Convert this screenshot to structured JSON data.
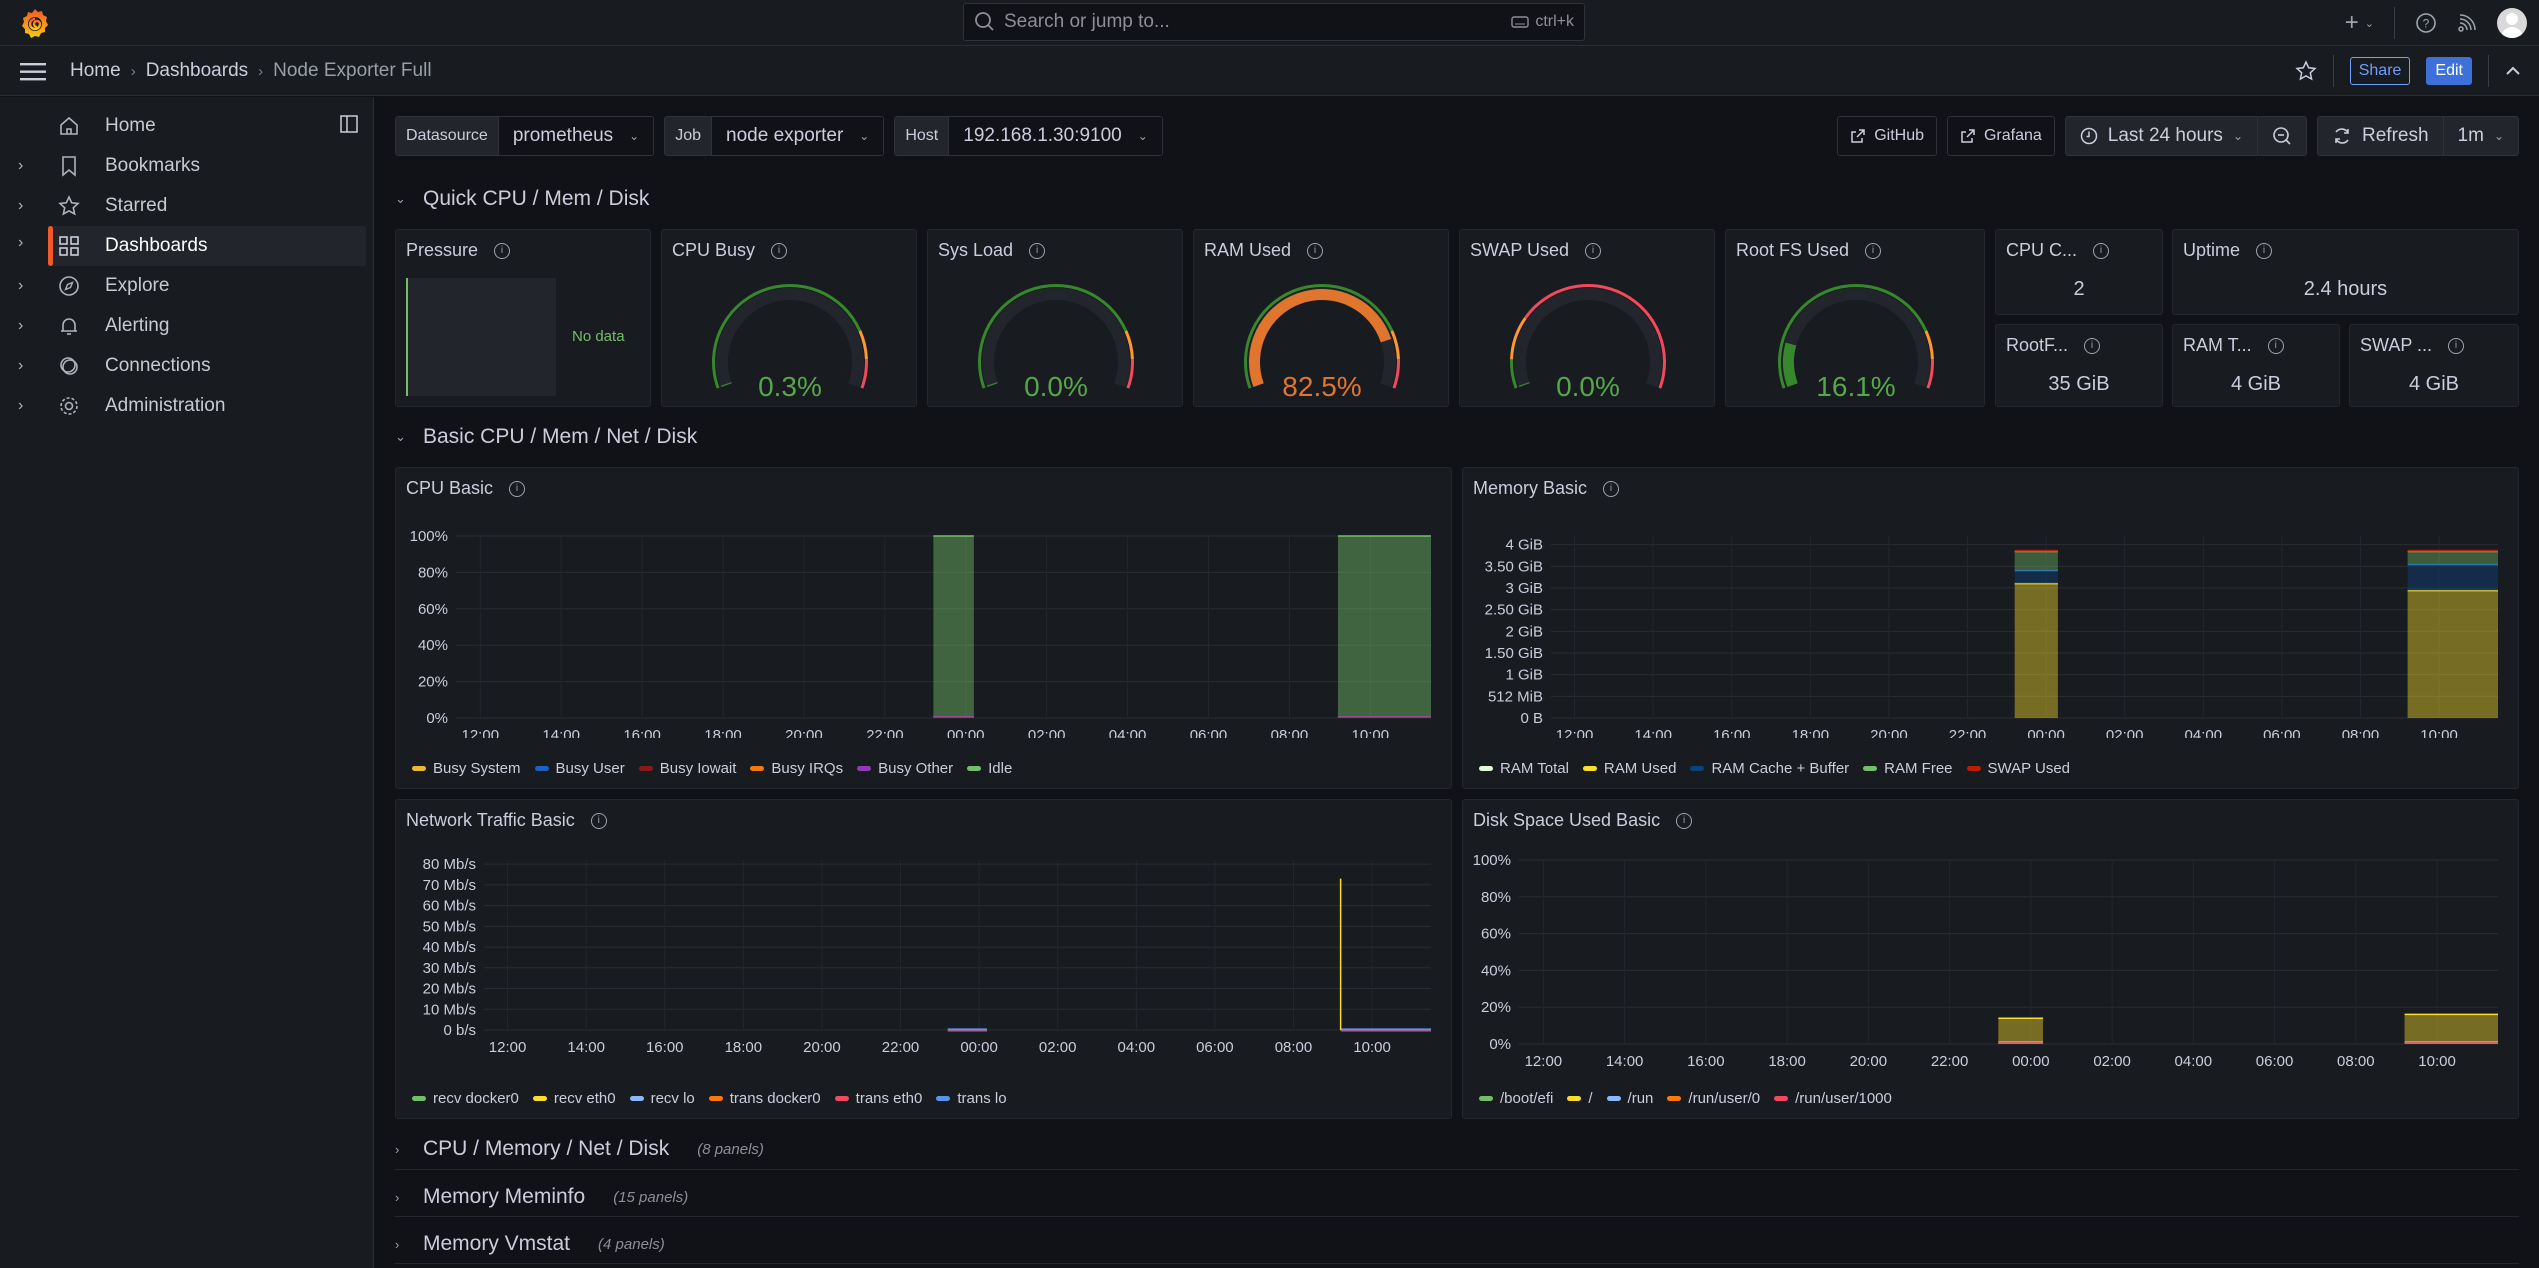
{
  "topbar": {
    "search_placeholder": "Search or jump to...",
    "search_shortcut": "ctrl+k",
    "icons": [
      "grafana-logo",
      "plus-icon",
      "help-icon",
      "news-rss-icon",
      "user-avatar"
    ]
  },
  "breadcrumb": {
    "items": [
      "Home",
      "Dashboards",
      "Node Exporter Full"
    ]
  },
  "navbar": {
    "share_label": "Share",
    "edit_label": "Edit"
  },
  "sidebar": {
    "items": [
      {
        "label": "Home",
        "icon": "home-icon",
        "expandable": false
      },
      {
        "label": "Bookmarks",
        "icon": "bookmark-icon",
        "expandable": true
      },
      {
        "label": "Starred",
        "icon": "star-icon",
        "expandable": true
      },
      {
        "label": "Dashboards",
        "icon": "apps-icon",
        "expandable": true,
        "active": true
      },
      {
        "label": "Explore",
        "icon": "compass-icon",
        "expandable": true
      },
      {
        "label": "Alerting",
        "icon": "bell-icon",
        "expandable": true
      },
      {
        "label": "Connections",
        "icon": "connections-icon",
        "expandable": true
      },
      {
        "label": "Administration",
        "icon": "cog-icon",
        "expandable": true
      }
    ]
  },
  "variables": [
    {
      "label": "Datasource",
      "value": "prometheus"
    },
    {
      "label": "Job",
      "value": "node exporter"
    },
    {
      "label": "Host",
      "value": "192.168.1.30:9100"
    }
  ],
  "controls": {
    "links": [
      "GitHub",
      "Grafana"
    ],
    "time_range": "Last 24 hours",
    "refresh_label": "Refresh",
    "refresh_interval": "1m"
  },
  "rows": [
    {
      "title": "Quick CPU / Mem / Disk",
      "expanded": true
    },
    {
      "title": "Basic CPU / Mem / Net / Disk",
      "expanded": true
    },
    {
      "title": "CPU / Memory / Net / Disk",
      "expanded": false,
      "count": "(8 panels)"
    },
    {
      "title": "Memory Meminfo",
      "expanded": false,
      "count": "(15 panels)"
    },
    {
      "title": "Memory Vmstat",
      "expanded": false,
      "count": "(4 panels)"
    }
  ],
  "quick_panels": {
    "pressure": {
      "title": "Pressure",
      "value": "No data"
    },
    "gauges": [
      {
        "title": "CPU Busy",
        "value": "0.3%",
        "fraction": 0.003,
        "color": "#37872d",
        "text_color": "#56a64b",
        "thresholds": "green-orange-red"
      },
      {
        "title": "Sys Load",
        "value": "0.0%",
        "fraction": 0.0,
        "color": "#37872d",
        "text_color": "#56a64b",
        "thresholds": "green-orange-red"
      },
      {
        "title": "RAM Used",
        "value": "82.5%",
        "fraction": 0.825,
        "color": "#e0752d",
        "text_color": "#e0752d",
        "thresholds": "green-orange-red"
      },
      {
        "title": "SWAP Used",
        "value": "0.0%",
        "fraction": 0.0,
        "color": "#37872d",
        "text_color": "#56a64b",
        "thresholds": "green-orange-red-swap"
      },
      {
        "title": "Root FS Used",
        "value": "16.1%",
        "fraction": 0.161,
        "color": "#37872d",
        "text_color": "#56a64b",
        "thresholds": "green-orange-red"
      }
    ],
    "stats": [
      {
        "title": "CPU C...",
        "value": "2"
      },
      {
        "title": "Uptime",
        "value": "2.4 hours"
      },
      {
        "title": "RootF...",
        "value": "35 GiB"
      },
      {
        "title": "RAM T...",
        "value": "4 GiB"
      },
      {
        "title": "SWAP ...",
        "value": "4 GiB"
      }
    ]
  },
  "chart_data": [
    {
      "type": "area",
      "title": "CPU Basic",
      "x_ticks": [
        "12:00",
        "14:00",
        "16:00",
        "18:00",
        "20:00",
        "22:00",
        "00:00",
        "02:00",
        "04:00",
        "06:00",
        "08:00",
        "10:00"
      ],
      "y_ticks": [
        "0%",
        "20%",
        "40%",
        "60%",
        "80%",
        "100%"
      ],
      "ylim": [
        0,
        100
      ],
      "x_range_hours": [
        11.4,
        35.5
      ],
      "series": [
        {
          "name": "Busy System",
          "color": "#eab839",
          "segments": [
            [
              23.2,
              24.2,
              0.2
            ],
            [
              33.2,
              35.5,
              0.2
            ]
          ]
        },
        {
          "name": "Busy User",
          "color": "#1f60c4",
          "segments": [
            [
              23.2,
              24.2,
              0.1
            ],
            [
              33.2,
              35.5,
              0.1
            ]
          ]
        },
        {
          "name": "Busy Iowait",
          "color": "#8a1a1a",
          "segments": [
            [
              23.2,
              24.2,
              0.0
            ],
            [
              33.2,
              35.5,
              0.0
            ]
          ]
        },
        {
          "name": "Busy IRQs",
          "color": "#f2790f",
          "segments": [
            [
              23.2,
              24.2,
              0.0
            ],
            [
              33.2,
              35.5,
              0.0
            ]
          ]
        },
        {
          "name": "Busy Other",
          "color": "#8f3bb8",
          "segments": [
            [
              23.2,
              24.2,
              0.0
            ],
            [
              33.2,
              35.5,
              0.0
            ]
          ]
        },
        {
          "name": "Idle",
          "color": "#73bf69",
          "segments": [
            [
              23.2,
              24.2,
              99.7
            ],
            [
              33.2,
              35.5,
              99.7
            ]
          ]
        }
      ]
    },
    {
      "type": "area",
      "title": "Memory Basic",
      "x_ticks": [
        "12:00",
        "14:00",
        "16:00",
        "18:00",
        "20:00",
        "22:00",
        "00:00",
        "02:00",
        "04:00",
        "06:00",
        "08:00",
        "10:00"
      ],
      "y_ticks": [
        "0 B",
        "512 MiB",
        "1 GiB",
        "1.50 GiB",
        "2 GiB",
        "2.50 GiB",
        "3 GiB",
        "3.50 GiB",
        "4 GiB"
      ],
      "ylim_gib": [
        0,
        4.2
      ],
      "x_range_hours": [
        11.4,
        35.5
      ],
      "series": [
        {
          "name": "RAM Total",
          "color": "#e0f9d7",
          "segments": [
            [
              23.2,
              24.3,
              3.84
            ],
            [
              33.2,
              35.5,
              3.84
            ]
          ]
        },
        {
          "name": "RAM Used",
          "color": "#fade2a",
          "segments": [
            [
              23.2,
              24.3,
              3.1
            ],
            [
              33.2,
              35.5,
              2.94
            ]
          ]
        },
        {
          "name": "RAM Cache + Buffer",
          "color": "#0a437c",
          "segments": [
            [
              23.2,
              24.3,
              0.3
            ],
            [
              33.2,
              35.5,
              0.6
            ]
          ]
        },
        {
          "name": "RAM Free",
          "color": "#73bf69",
          "segments": [
            [
              23.2,
              24.3,
              0.44
            ],
            [
              33.2,
              35.5,
              0.3
            ]
          ]
        },
        {
          "name": "SWAP Used",
          "color": "#bf1b00",
          "segments": [
            [
              23.2,
              24.3,
              0.0
            ],
            [
              33.2,
              35.5,
              0.0
            ]
          ]
        }
      ]
    },
    {
      "type": "line",
      "title": "Network Traffic Basic",
      "x_ticks": [
        "12:00",
        "14:00",
        "16:00",
        "18:00",
        "20:00",
        "22:00",
        "00:00",
        "02:00",
        "04:00",
        "06:00",
        "08:00",
        "10:00"
      ],
      "y_ticks": [
        "0 b/s",
        "10 Mb/s",
        "20 Mb/s",
        "30 Mb/s",
        "40 Mb/s",
        "50 Mb/s",
        "60 Mb/s",
        "70 Mb/s",
        "80 Mb/s"
      ],
      "ylim_mbps": [
        0,
        80
      ],
      "x_range_hours": [
        11.4,
        35.5
      ],
      "series": [
        {
          "name": "recv docker0",
          "color": "#73bf69",
          "peak_mbps": 0
        },
        {
          "name": "recv eth0",
          "color": "#fade2a",
          "peak_mbps": 73,
          "peak_at_hour": 33.2
        },
        {
          "name": "recv lo",
          "color": "#8ab8ff",
          "peak_mbps": 0.2
        },
        {
          "name": "trans docker0",
          "color": "#ff780a",
          "peak_mbps": 0
        },
        {
          "name": "trans eth0",
          "color": "#f2495c",
          "peak_mbps": 0.2
        },
        {
          "name": "trans lo",
          "color": "#5794f2",
          "peak_mbps": 0.2
        }
      ],
      "active_segments": [
        [
          23.2,
          24.2
        ],
        [
          33.2,
          35.5
        ]
      ]
    },
    {
      "type": "area",
      "title": "Disk Space Used Basic",
      "x_ticks": [
        "12:00",
        "14:00",
        "16:00",
        "18:00",
        "20:00",
        "22:00",
        "00:00",
        "02:00",
        "04:00",
        "06:00",
        "08:00",
        "10:00"
      ],
      "y_ticks": [
        "0%",
        "20%",
        "40%",
        "60%",
        "80%",
        "100%"
      ],
      "ylim": [
        0,
        100
      ],
      "x_range_hours": [
        11.4,
        35.5
      ],
      "series": [
        {
          "name": "/boot/efi",
          "color": "#73bf69",
          "segments": [
            [
              23.2,
              24.3,
              1.2
            ],
            [
              33.2,
              35.5,
              1.2
            ]
          ]
        },
        {
          "name": "/",
          "color": "#fade2a",
          "segments": [
            [
              23.2,
              24.3,
              14
            ],
            [
              33.2,
              35.5,
              16.1
            ]
          ]
        },
        {
          "name": "/run",
          "color": "#8ab8ff",
          "segments": [
            [
              23.2,
              24.3,
              0.5
            ],
            [
              33.2,
              35.5,
              0.5
            ]
          ]
        },
        {
          "name": "/run/user/0",
          "color": "#ff780a",
          "segments": [
            [
              23.2,
              24.3,
              0.0
            ],
            [
              33.2,
              35.5,
              0.0
            ]
          ]
        },
        {
          "name": "/run/user/1000",
          "color": "#f2495c",
          "segments": [
            [
              23.2,
              24.3,
              0.0
            ],
            [
              33.2,
              35.5,
              0.0
            ]
          ]
        }
      ]
    }
  ]
}
